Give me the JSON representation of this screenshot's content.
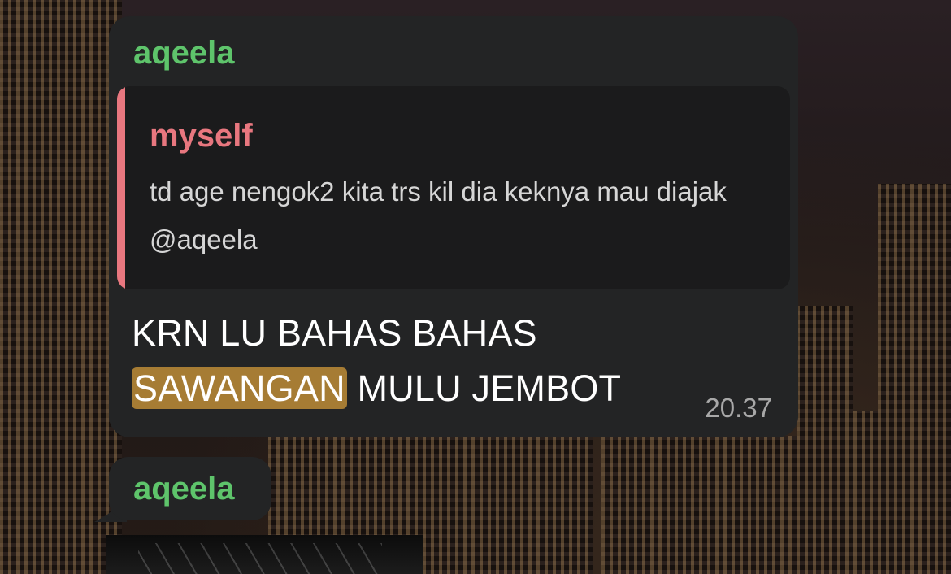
{
  "message": {
    "sender": "aqeela",
    "reply": {
      "author": "myself",
      "text": "td age nengok2 kita trs kil dia keknya mau diajak",
      "mention": "@aqeela"
    },
    "text_part1": "KRN LU BAHAS BAHAS",
    "highlighted_word": "SAWANGAN",
    "text_part2": "MULU JEMBOT",
    "time": "20.37"
  },
  "next_message": {
    "sender": "aqeela"
  },
  "colors": {
    "sender_name": "#5ec46b",
    "reply_accent": "#e8777f",
    "highlight": "#a67c34",
    "bubble": "#232425"
  }
}
